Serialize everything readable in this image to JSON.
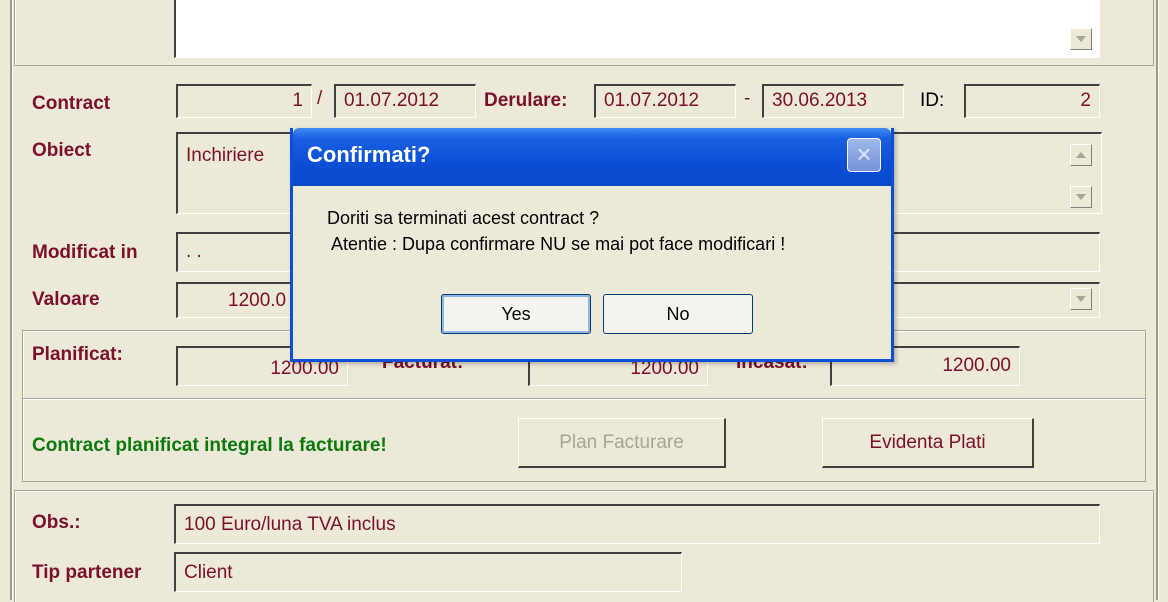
{
  "form": {
    "contract_label": "Contract",
    "contract_no": "1",
    "contract_sep": "/",
    "contract_date": "01.07.2012",
    "derulare_label": "Derulare:",
    "derulare_start": "01.07.2012",
    "derulare_dash": "-",
    "derulare_end": "30.06.2013",
    "id_label": "ID:",
    "id_value": "2",
    "obiect_label": "Obiect",
    "obiect_value": "Inchiriere",
    "modificat_label": "Modificat in",
    "modificat_value": ". .",
    "valoare_label": "Valoare",
    "valoare_value": "1200.0",
    "planificat_label": "Planificat:",
    "planificat_value": "1200.00",
    "facturat_label": "Facturat:",
    "facturat_value": "1200.00",
    "incasat_label": "Incasat:",
    "incasat_value": "1200.00",
    "status_message": "Contract planificat integral la facturare!",
    "plan_facturare_button": "Plan Facturare",
    "evidenta_plati_button": "Evidenta Plati",
    "obs_label": "Obs.:",
    "obs_value": "100 Euro/luna TVA inclus",
    "tip_partener_label": "Tip partener",
    "tip_partener_value": "Client"
  },
  "dialog": {
    "title": "Confirmati?",
    "close_glyph": "×",
    "message_line1": "Doriti sa terminati acest contract ?",
    "message_line2": " Atentie : Dupa confirmare NU se mai pot face modificari !",
    "yes_label": "Yes",
    "no_label": "No"
  },
  "colors": {
    "label": "#7b0f2c",
    "status": "#0b7a0b",
    "dialog_title_bar": "#0b4fd6",
    "window_bg": "#ece9d8"
  }
}
